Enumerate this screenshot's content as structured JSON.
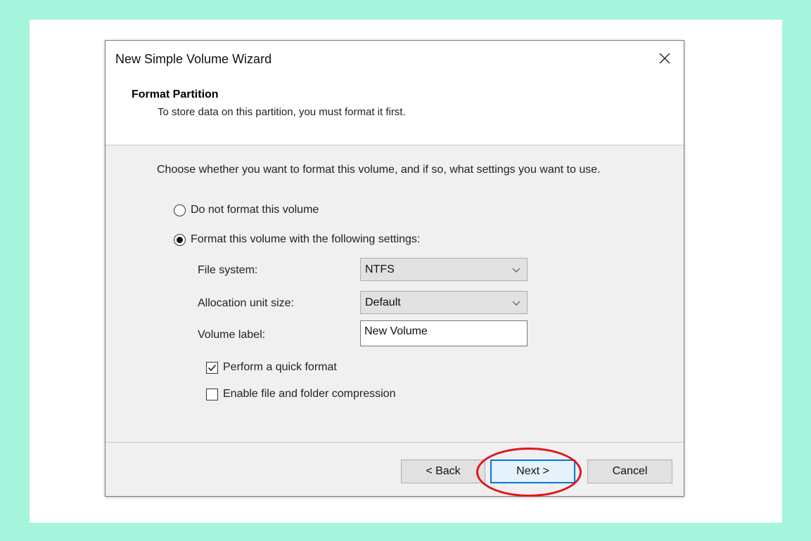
{
  "window": {
    "title": "New Simple Volume Wizard",
    "close_icon": "close-icon"
  },
  "header": {
    "title": "Format Partition",
    "subtitle": "To store data on this partition, you must format it first."
  },
  "body": {
    "instruction": "Choose whether you want to format this volume, and if so, what settings you want to use.",
    "radio_options": [
      {
        "label": "Do not format this volume",
        "selected": false
      },
      {
        "label": "Format this volume with the following settings:",
        "selected": true
      }
    ],
    "fields": {
      "file_system": {
        "label": "File system:",
        "value": "NTFS"
      },
      "allocation_unit_size": {
        "label": "Allocation unit size:",
        "value": "Default"
      },
      "volume_label": {
        "label": "Volume label:",
        "value": "New Volume"
      }
    },
    "checkboxes": [
      {
        "label": "Perform a quick format",
        "checked": true
      },
      {
        "label": "Enable file and folder compression",
        "checked": false
      }
    ]
  },
  "footer": {
    "back_label": "< Back",
    "next_label": "Next >",
    "cancel_label": "Cancel"
  },
  "colors": {
    "page_background": "#a5f5dc",
    "accent": "#0078d7",
    "highlight": "#e3141a"
  }
}
